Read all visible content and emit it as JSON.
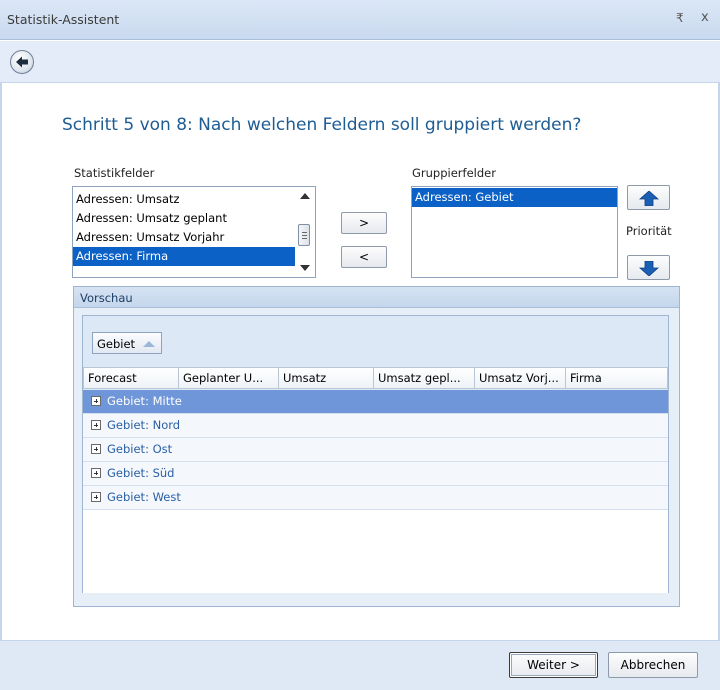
{
  "window": {
    "title": "Statistik-Assistent",
    "pin_glyph": "₹",
    "close_glyph": "x"
  },
  "heading": "Schritt 5 von 8: Nach welchen Feldern soll gruppiert werden?",
  "statistikfelder": {
    "label": "Statistikfelder",
    "items": [
      {
        "label": "Adressen: Umsatz",
        "selected": false
      },
      {
        "label": "Adressen: Umsatz geplant",
        "selected": false
      },
      {
        "label": "Adressen: Umsatz Vorjahr",
        "selected": false
      },
      {
        "label": "Adressen: Firma",
        "selected": true
      }
    ]
  },
  "transfer": {
    "add_label": ">",
    "remove_label": "<"
  },
  "gruppierfelder": {
    "label": "Gruppierfelder",
    "items": [
      {
        "label": "Adressen: Gebiet",
        "selected": true
      }
    ]
  },
  "priority": {
    "label": "Priorität",
    "up_icon": "arrow-up-icon",
    "down_icon": "arrow-down-icon"
  },
  "preview": {
    "title": "Vorschau",
    "group_chip": "Gebiet",
    "columns": [
      "Forecast",
      "Geplanter U...",
      "Umsatz",
      "Umsatz gepl...",
      "Umsatz Vorj...",
      "Firma"
    ],
    "rows": [
      {
        "label": "Gebiet: Mitte",
        "selected": true
      },
      {
        "label": "Gebiet: Nord",
        "selected": false
      },
      {
        "label": "Gebiet: Ost",
        "selected": false
      },
      {
        "label": "Gebiet: Süd",
        "selected": false
      },
      {
        "label": "Gebiet: West",
        "selected": false
      }
    ]
  },
  "footer": {
    "next_label": "Weiter >",
    "cancel_label": "Abbrechen"
  },
  "colors": {
    "accent": "#0b61c6",
    "heading": "#1e5c94",
    "row_selected": "#6f96d9"
  }
}
